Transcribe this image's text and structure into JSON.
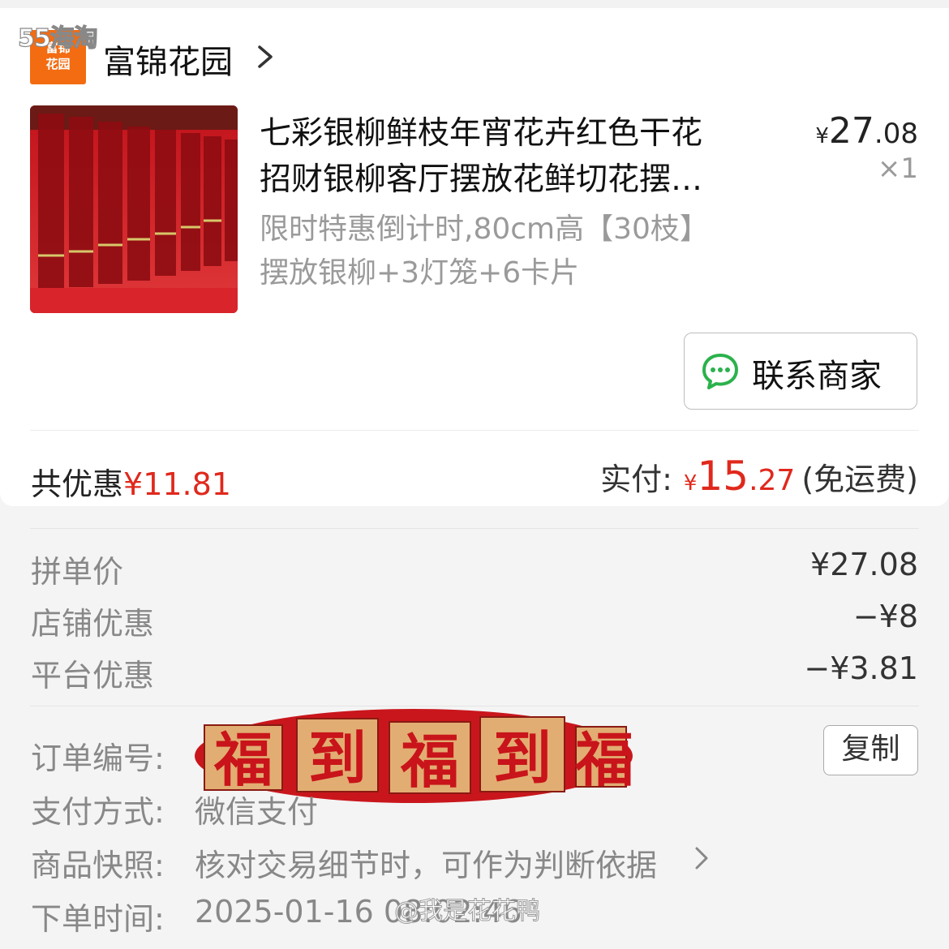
{
  "watermarks": {
    "top": "55海淘",
    "bottom": "@我是花花鸭"
  },
  "store": {
    "logo_text_line1": "富锦",
    "logo_text_line2": "花园",
    "name": "富锦花园"
  },
  "product": {
    "title": "七彩银柳鲜枝年宵花卉红色干花\n招财银柳客厅摆放花鲜切花摆…",
    "price_yen": "¥",
    "price_int": "27",
    "price_dec": ".08",
    "quantity": "×1",
    "spec": "限时特惠倒计时,80cm高【30枝】\n摆放银柳+3灯笼+6卡片"
  },
  "contact_button": {
    "label": "联系商家"
  },
  "summary": {
    "discount_prefix": "共优惠",
    "discount_amount": "¥11.81",
    "paid_label": "实付:",
    "paid_yen": "¥",
    "paid_int": "15",
    "paid_dec": ".27",
    "shipping_note": "(免运费)"
  },
  "price_breakdown": [
    {
      "label": "拼单价",
      "value": "¥27.08"
    },
    {
      "label": "店铺优惠",
      "value": "−¥8"
    },
    {
      "label": "平台优惠",
      "value": "−¥3.81"
    }
  ],
  "order_info": {
    "order_no_label": "订单编号:",
    "copy_label": "复制",
    "payment_label": "支付方式:",
    "payment_value": "微信支付",
    "snapshot_label": "商品快照:",
    "snapshot_value": "核对交易细节时，可作为判断依据",
    "time_label": "下单时间:",
    "time_value": "2025-01-16 08:02:46"
  },
  "sticker": {
    "chars": [
      "福",
      "到",
      "福",
      "到",
      "福"
    ]
  },
  "colors": {
    "accent_red": "#e0281c",
    "store_orange": "#f36c12",
    "wechat_green": "#2bb24c"
  }
}
